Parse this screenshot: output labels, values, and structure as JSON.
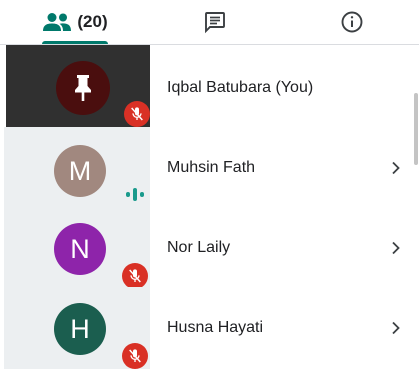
{
  "tabs": {
    "people": {
      "icon": "people-icon",
      "count_label": "(20)"
    },
    "chat": {
      "icon": "chat-icon"
    },
    "info": {
      "icon": "info-icon"
    }
  },
  "colors": {
    "accent": "#00796b",
    "mute_badge": "#d93025",
    "speaking": "#1a9a8c"
  },
  "participants": [
    {
      "name": "Iqbal Batubara (You)",
      "avatar_type": "pin-icon",
      "muted": true,
      "self": true
    },
    {
      "name": "Muhsin Fath",
      "initial": "M",
      "avatar_color": "#a1887f",
      "muted": false,
      "speaking": true
    },
    {
      "name": "Nor Laily",
      "initial": "N",
      "avatar_color": "#8e24aa",
      "muted": true
    },
    {
      "name": "Husna Hayati",
      "initial": "H",
      "avatar_color": "#1b5e4f",
      "muted": true
    }
  ]
}
